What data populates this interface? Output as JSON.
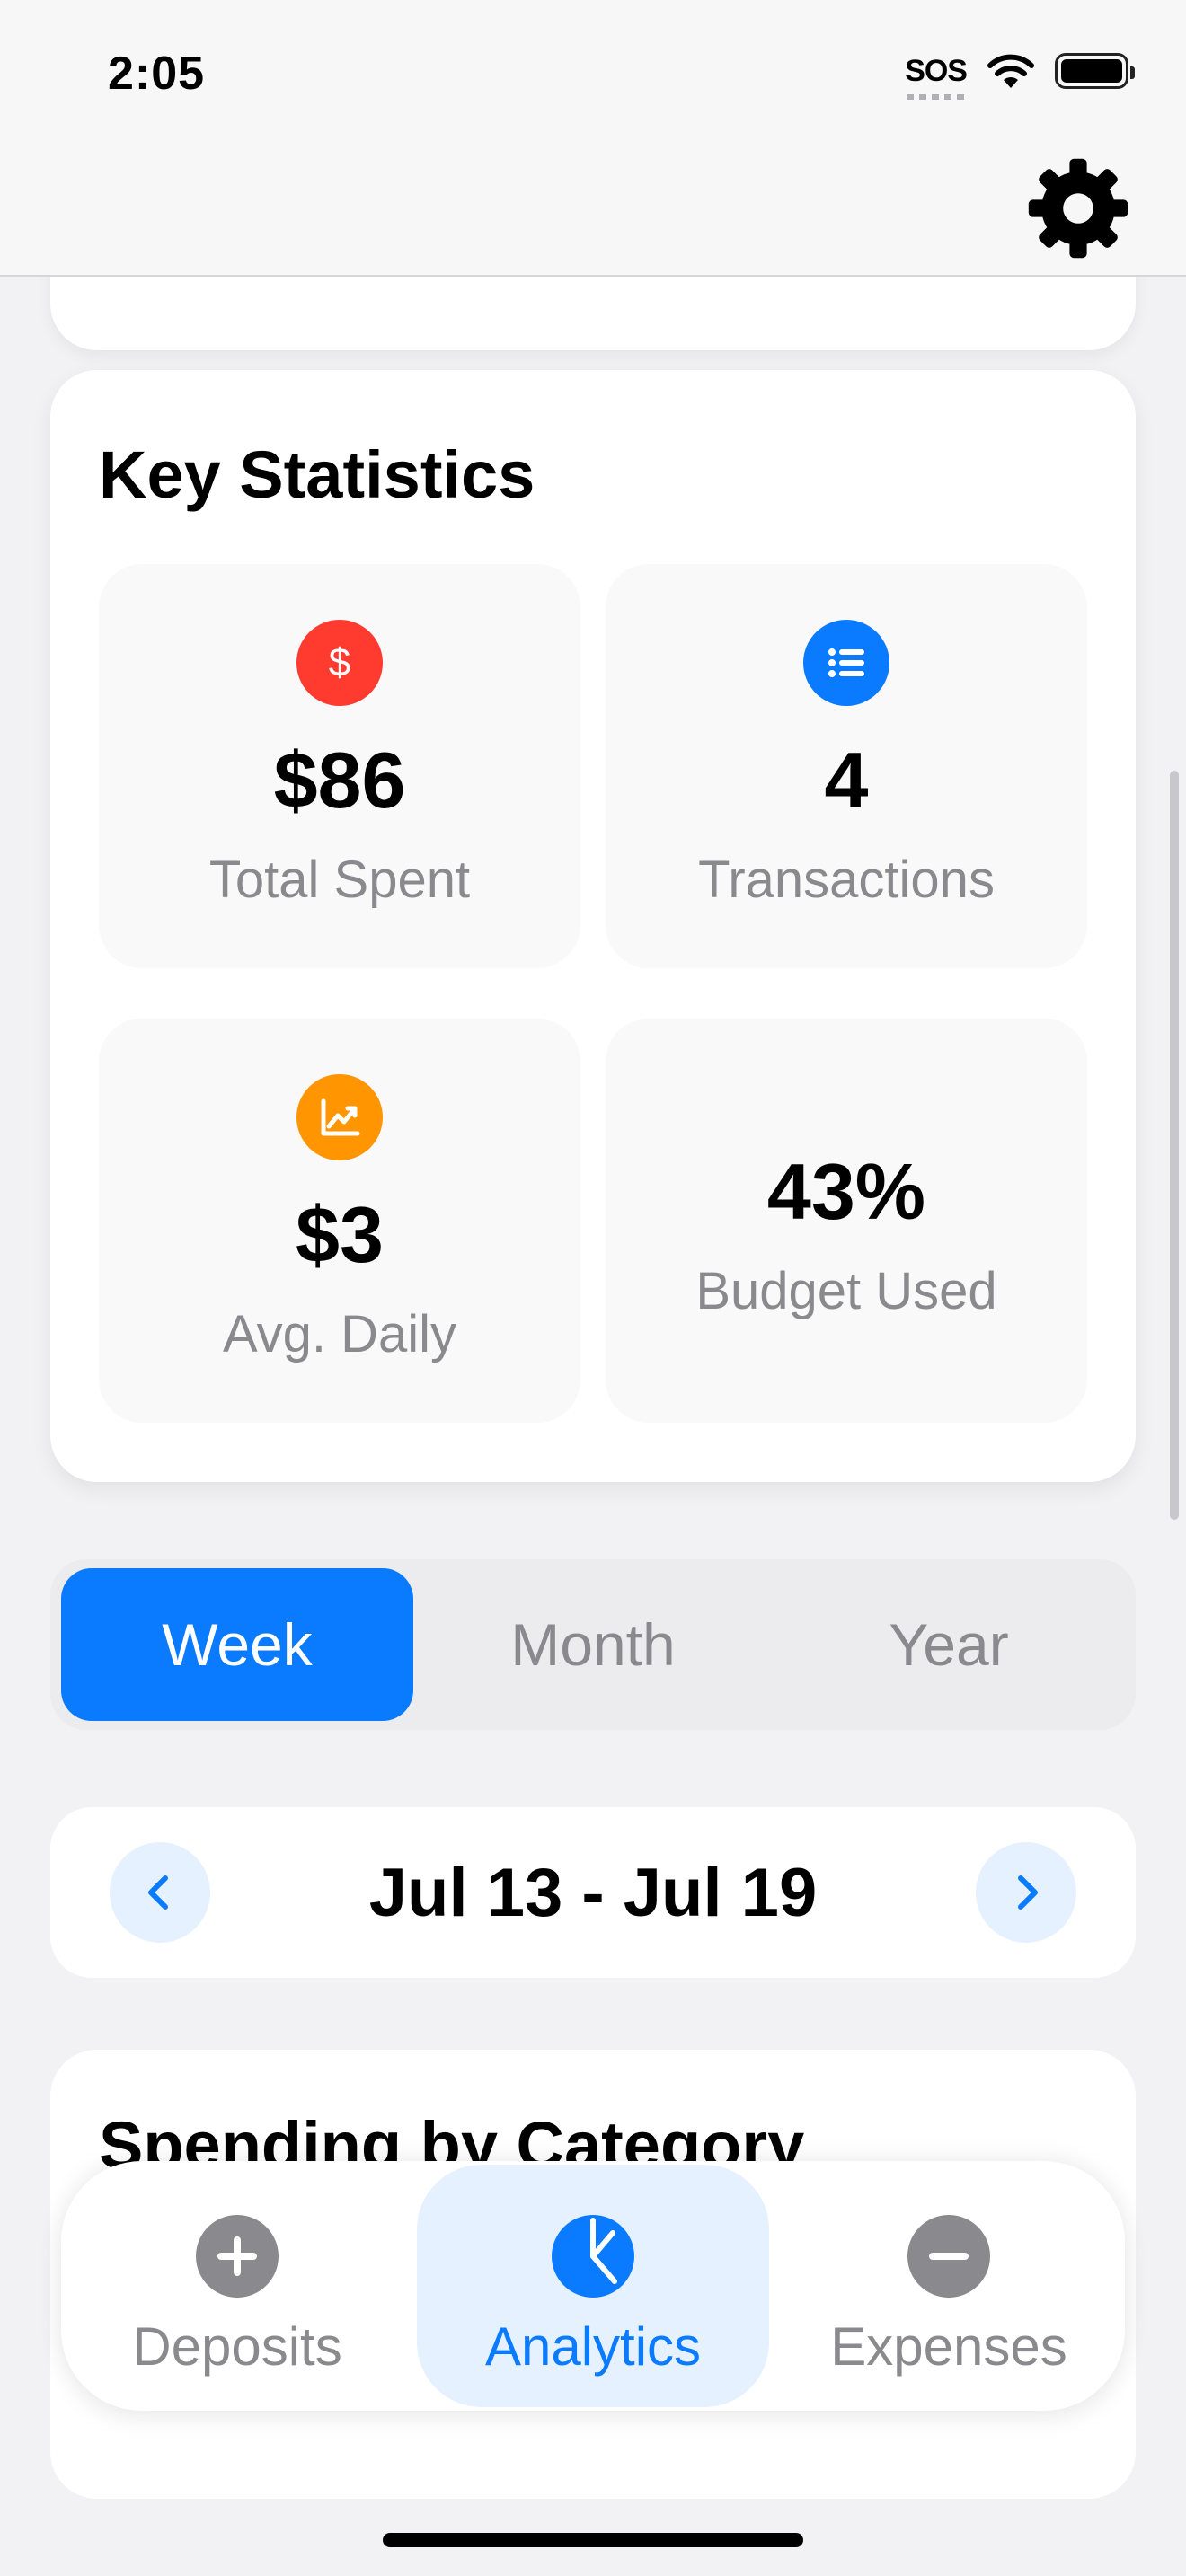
{
  "status_bar": {
    "time": "2:05",
    "sos": "SOS"
  },
  "key_statistics": {
    "title": "Key Statistics",
    "stats": [
      {
        "value": "$86",
        "label": "Total Spent",
        "icon": "dollar-icon",
        "color": "#ff3b30"
      },
      {
        "value": "4",
        "label": "Transactions",
        "icon": "list-icon",
        "color": "#0a7aff"
      },
      {
        "value": "$3",
        "label": "Avg. Daily",
        "icon": "chart-line-icon",
        "color": "#ff9500"
      },
      {
        "value": "43%",
        "label": "Budget Used"
      }
    ]
  },
  "period_selector": {
    "options": [
      "Week",
      "Month",
      "Year"
    ],
    "selected": "Week"
  },
  "date_range": {
    "label": "Jul 13 - Jul 19"
  },
  "spending_card": {
    "title": "Spending by Category"
  },
  "tab_bar": {
    "tabs": [
      {
        "label": "Deposits",
        "icon": "plus-circle-icon"
      },
      {
        "label": "Analytics",
        "icon": "pie-chart-icon",
        "active": true
      },
      {
        "label": "Expenses",
        "icon": "minus-circle-icon"
      }
    ]
  },
  "colors": {
    "accent": "#0a7aff",
    "label_gray": "#8a8a8e"
  }
}
